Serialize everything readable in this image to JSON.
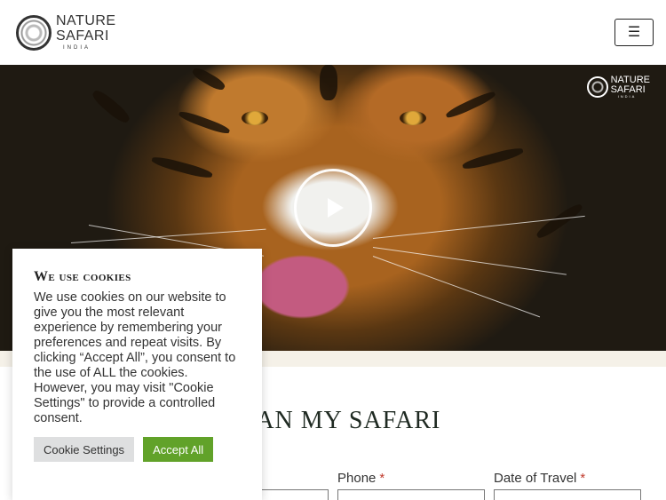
{
  "header": {
    "logo_line1": "NATURE",
    "logo_line2": "SAFARI",
    "logo_line3": "INDIA",
    "menu_icon": "hamburger-icon"
  },
  "hero": {
    "badge_line1": "NATURE",
    "badge_line2": "SAFARI",
    "badge_line3": "INDIA",
    "play_icon": "play-icon"
  },
  "form": {
    "title": "PLAN MY SAFARI",
    "fields": [
      {
        "label": "Phone",
        "required": "*"
      },
      {
        "label": "Date of Travel",
        "required": "*"
      }
    ]
  },
  "cookie": {
    "title": "We use cookies",
    "body": "We use cookies on our website to give you the most relevant experience by remembering your preferences and repeat visits. By clicking “Accept All”, you consent to the use of ALL the cookies. However, you may visit \"Cookie Settings\" to provide a controlled consent.",
    "settings_label": "Cookie Settings",
    "accept_label": "Accept All",
    "accept_color": "#61a229"
  }
}
